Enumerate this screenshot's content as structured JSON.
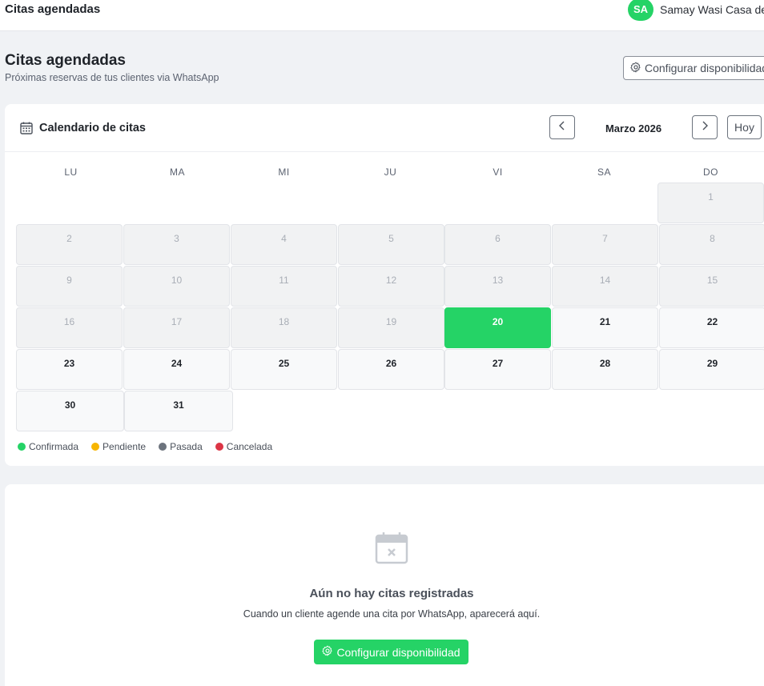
{
  "topbar": {
    "title": "Citas agendadas",
    "avatar_initials": "SA",
    "user_name": "Samay Wasi Casa de p"
  },
  "header": {
    "title": "Citas agendadas",
    "subtitle": "Próximas reservas de tus clientes via WhatsApp",
    "config_button": "Configurar disponibilidad"
  },
  "calendar": {
    "title": "Calendario de citas",
    "month": "Marzo 2026",
    "today_button": "Hoy",
    "weekdays": [
      "LU",
      "MA",
      "MI",
      "JU",
      "VI",
      "SA",
      "DO"
    ],
    "today": 20,
    "days": [
      "1",
      "2",
      "3",
      "4",
      "5",
      "6",
      "7",
      "8",
      "9",
      "10",
      "11",
      "12",
      "13",
      "14",
      "15",
      "16",
      "17",
      "18",
      "19",
      "20",
      "21",
      "22",
      "23",
      "24",
      "25",
      "26",
      "27",
      "28",
      "29",
      "30",
      "31"
    ]
  },
  "legend": [
    {
      "label": "Confirmada",
      "color": "#25d366"
    },
    {
      "label": "Pendiente",
      "color": "#f7b500"
    },
    {
      "label": "Pasada",
      "color": "#6c737d"
    },
    {
      "label": "Cancelada",
      "color": "#dc3545"
    }
  ],
  "empty_state": {
    "title": "Aún no hay citas registradas",
    "text": "Cuando un cliente agende una cita por WhatsApp, aparecerá aquí.",
    "button": "Configurar disponibilidad"
  },
  "colors": {
    "accent": "#25d366"
  }
}
